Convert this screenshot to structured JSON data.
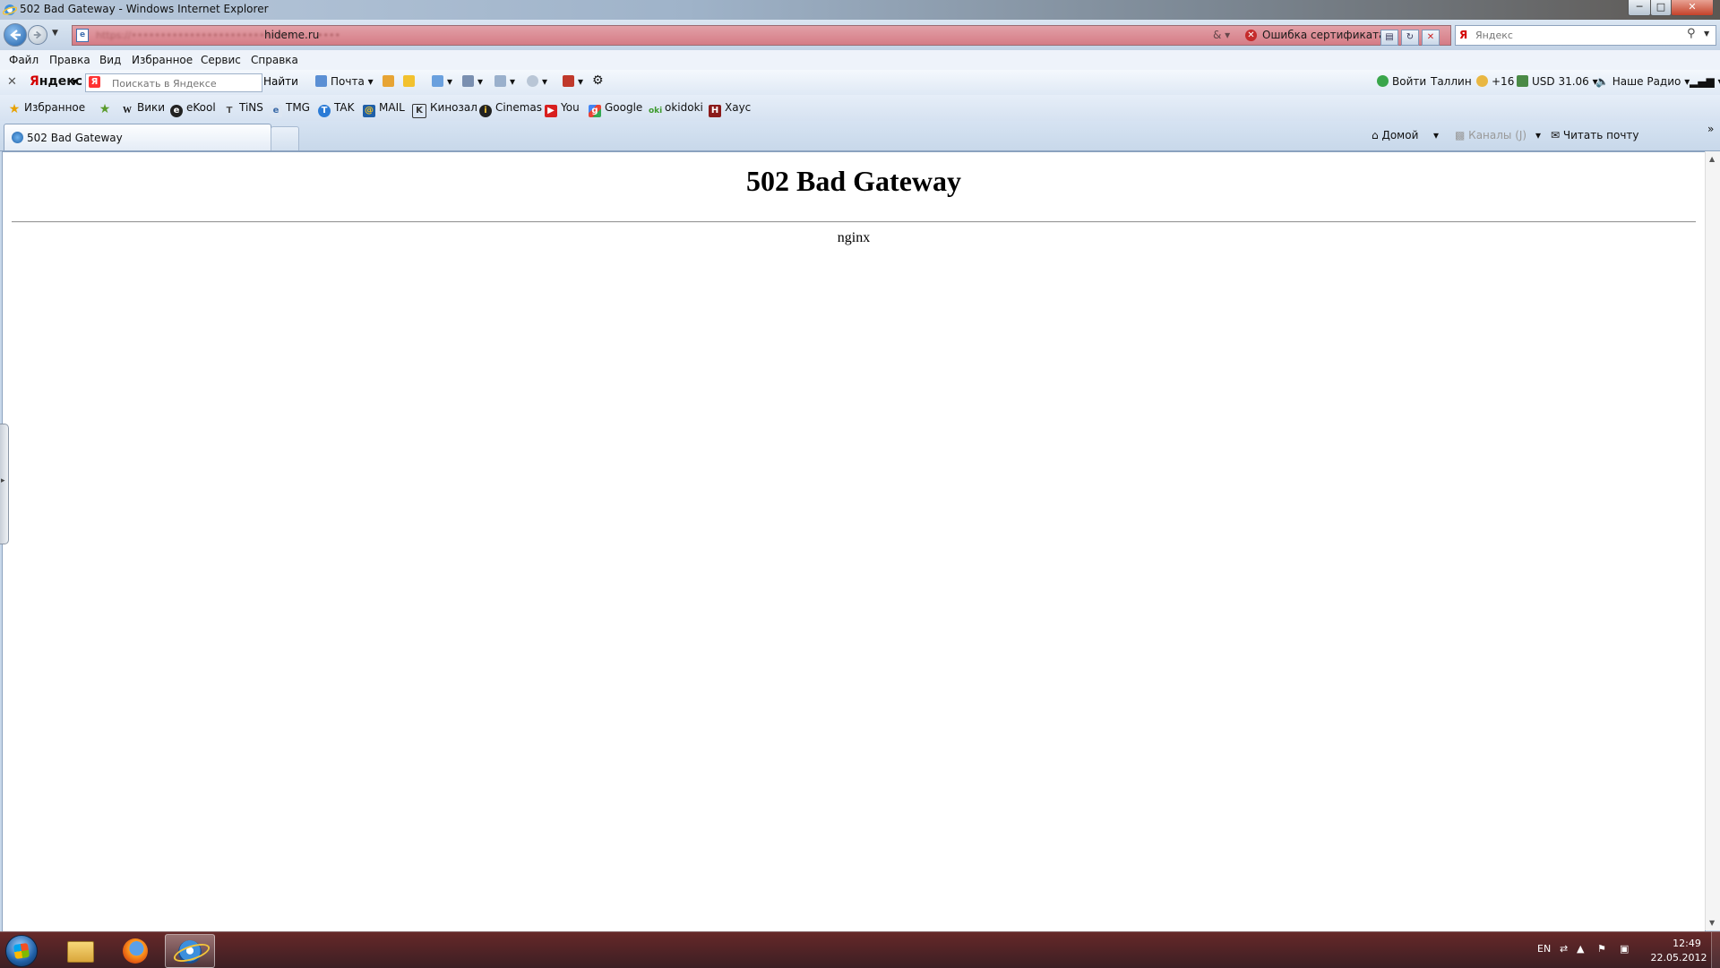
{
  "window": {
    "title": "502 Bad Gateway - Windows Internet Explorer"
  },
  "address": {
    "url_blurred": "https://••••••••••••••••••••••••••••",
    "url_host": "hideme.ru",
    "url_tail": "••••",
    "cert_error": "Ошибка сертификата",
    "search_placeholder": "Яндекс"
  },
  "menu": [
    "Файл",
    "Правка",
    "Вид",
    "Избранное",
    "Сервис",
    "Справка"
  ],
  "yandex_bar": {
    "logo": "Яндекс",
    "search_placeholder": "Поискать в Яндексе",
    "find_label": "Найти",
    "mail_label": "Почта",
    "login_label": "Войти",
    "city": "Таллин",
    "weather": "+16",
    "currency": "USD 31.06",
    "radio": "Наше Радио"
  },
  "favorites": {
    "label": "Избранное",
    "items": [
      "Вики",
      "eKool",
      "TiNS",
      "TMG",
      "TAK",
      "MAIL",
      "Кинозал",
      "Cinemas",
      "You",
      "Google",
      "okidoki",
      "Хаус"
    ]
  },
  "tabs": [
    {
      "label": "502 Bad Gateway"
    }
  ],
  "command_bar": {
    "home": "Домой",
    "feeds": "Каналы (J)",
    "read_mail": "Читать почту"
  },
  "page": {
    "heading": "502 Bad Gateway",
    "server": "nginx"
  },
  "taskbar": {
    "lang": "EN",
    "time": "12:49",
    "date": "22.05.2012"
  },
  "colors": {
    "address_error_bg": "#d57c86",
    "page_bg": "#ffffff",
    "taskbar_bg": "#3b2a2c"
  }
}
